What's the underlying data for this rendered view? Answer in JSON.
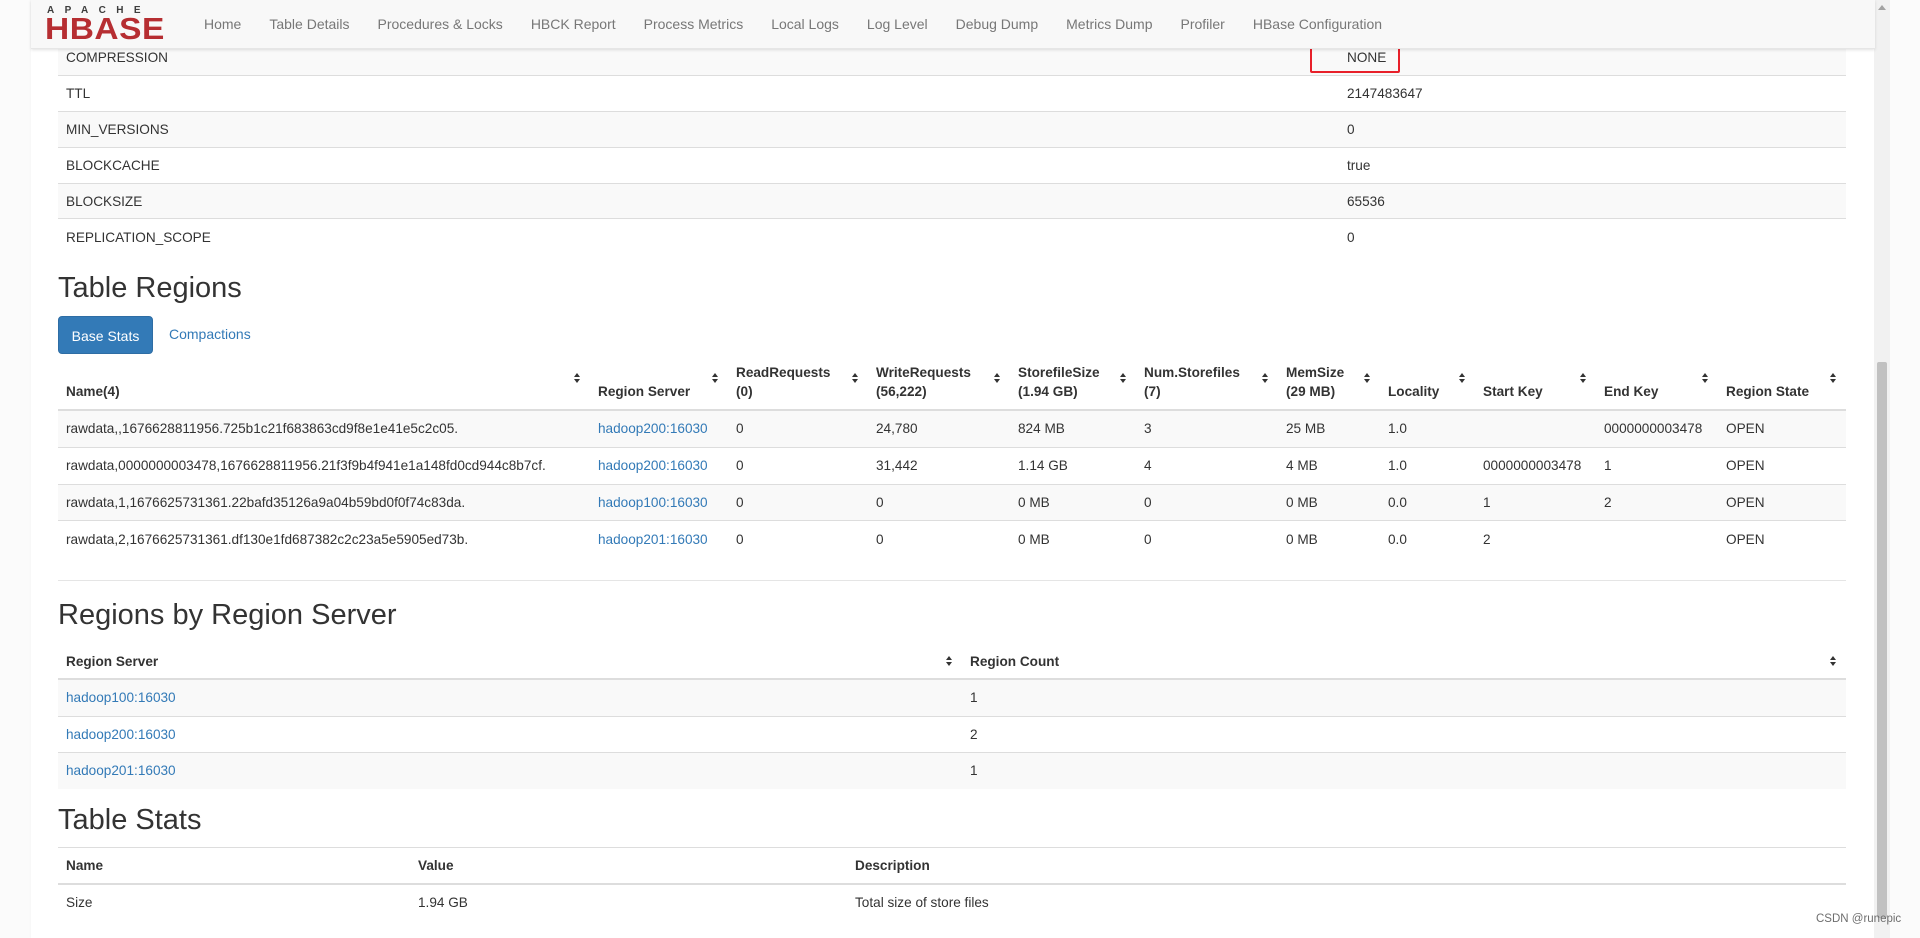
{
  "navbar": {
    "logo_top": "APACHE",
    "logo_main": "HBASE",
    "items": [
      {
        "label": "Home"
      },
      {
        "label": "Table Details"
      },
      {
        "label": "Procedures & Locks"
      },
      {
        "label": "HBCK Report"
      },
      {
        "label": "Process Metrics"
      },
      {
        "label": "Local Logs"
      },
      {
        "label": "Log Level"
      },
      {
        "label": "Debug Dump"
      },
      {
        "label": "Metrics Dump"
      },
      {
        "label": "Profiler"
      },
      {
        "label": "HBase Configuration"
      }
    ]
  },
  "column_family": {
    "rows": [
      {
        "property": "COMPRESSION",
        "value": "NONE"
      },
      {
        "property": "TTL",
        "value": "2147483647"
      },
      {
        "property": "MIN_VERSIONS",
        "value": "0"
      },
      {
        "property": "BLOCKCACHE",
        "value": "true"
      },
      {
        "property": "BLOCKSIZE",
        "value": "65536"
      },
      {
        "property": "REPLICATION_SCOPE",
        "value": "0"
      }
    ]
  },
  "table_regions": {
    "title": "Table Regions",
    "tabs": {
      "base_stats": "Base Stats",
      "compactions": "Compactions"
    },
    "headers": {
      "name": "Name(4)",
      "region_server": "Region Server",
      "read_requests": "ReadRequests",
      "read_requests_sub": "(0)",
      "write_requests": "WriteRequests",
      "write_requests_sub": "(56,222)",
      "storefile_size": "StorefileSize",
      "storefile_size_sub": "(1.94 GB)",
      "num_storefiles": "Num.Storefiles",
      "num_storefiles_sub": "(7)",
      "mem_size": "MemSize",
      "mem_size_sub": "(29 MB)",
      "locality": "Locality",
      "start_key": "Start Key",
      "end_key": "End Key",
      "region_state": "Region State"
    },
    "rows": [
      {
        "name": "rawdata,,1676628811956.725b1c21f683863cd9f8e1e41e5c2c05.",
        "server": "hadoop200:16030",
        "read": "0",
        "write": "24,780",
        "storefile": "824 MB",
        "num": "3",
        "mem": "25 MB",
        "locality": "1.0",
        "start": "",
        "end": "0000000003478",
        "state": "OPEN"
      },
      {
        "name": "rawdata,0000000003478,1676628811956.21f3f9b4f941e1a148fd0cd944c8b7cf.",
        "server": "hadoop200:16030",
        "read": "0",
        "write": "31,442",
        "storefile": "1.14 GB",
        "num": "4",
        "mem": "4 MB",
        "locality": "1.0",
        "start": "0000000003478",
        "end": "1",
        "state": "OPEN"
      },
      {
        "name": "rawdata,1,1676625731361.22bafd35126a9a04b59bd0f0f74c83da.",
        "server": "hadoop100:16030",
        "read": "0",
        "write": "0",
        "storefile": "0 MB",
        "num": "0",
        "mem": "0 MB",
        "locality": "0.0",
        "start": "1",
        "end": "2",
        "state": "OPEN"
      },
      {
        "name": "rawdata,2,1676625731361.df130e1fd687382c2c23a5e5905ed73b.",
        "server": "hadoop201:16030",
        "read": "0",
        "write": "0",
        "storefile": "0 MB",
        "num": "0",
        "mem": "0 MB",
        "locality": "0.0",
        "start": "2",
        "end": "",
        "state": "OPEN"
      }
    ]
  },
  "regions_by_server": {
    "title": "Regions by Region Server",
    "headers": {
      "server": "Region Server",
      "count": "Region Count"
    },
    "rows": [
      {
        "server": "hadoop100:16030",
        "count": "1"
      },
      {
        "server": "hadoop200:16030",
        "count": "2"
      },
      {
        "server": "hadoop201:16030",
        "count": "1"
      }
    ]
  },
  "table_stats": {
    "title": "Table Stats",
    "headers": {
      "name": "Name",
      "value": "Value",
      "description": "Description"
    },
    "rows": [
      {
        "name": "Size",
        "value": "1.94 GB",
        "description": "Total size of store files"
      }
    ]
  },
  "watermark": "CSDN @runepic"
}
